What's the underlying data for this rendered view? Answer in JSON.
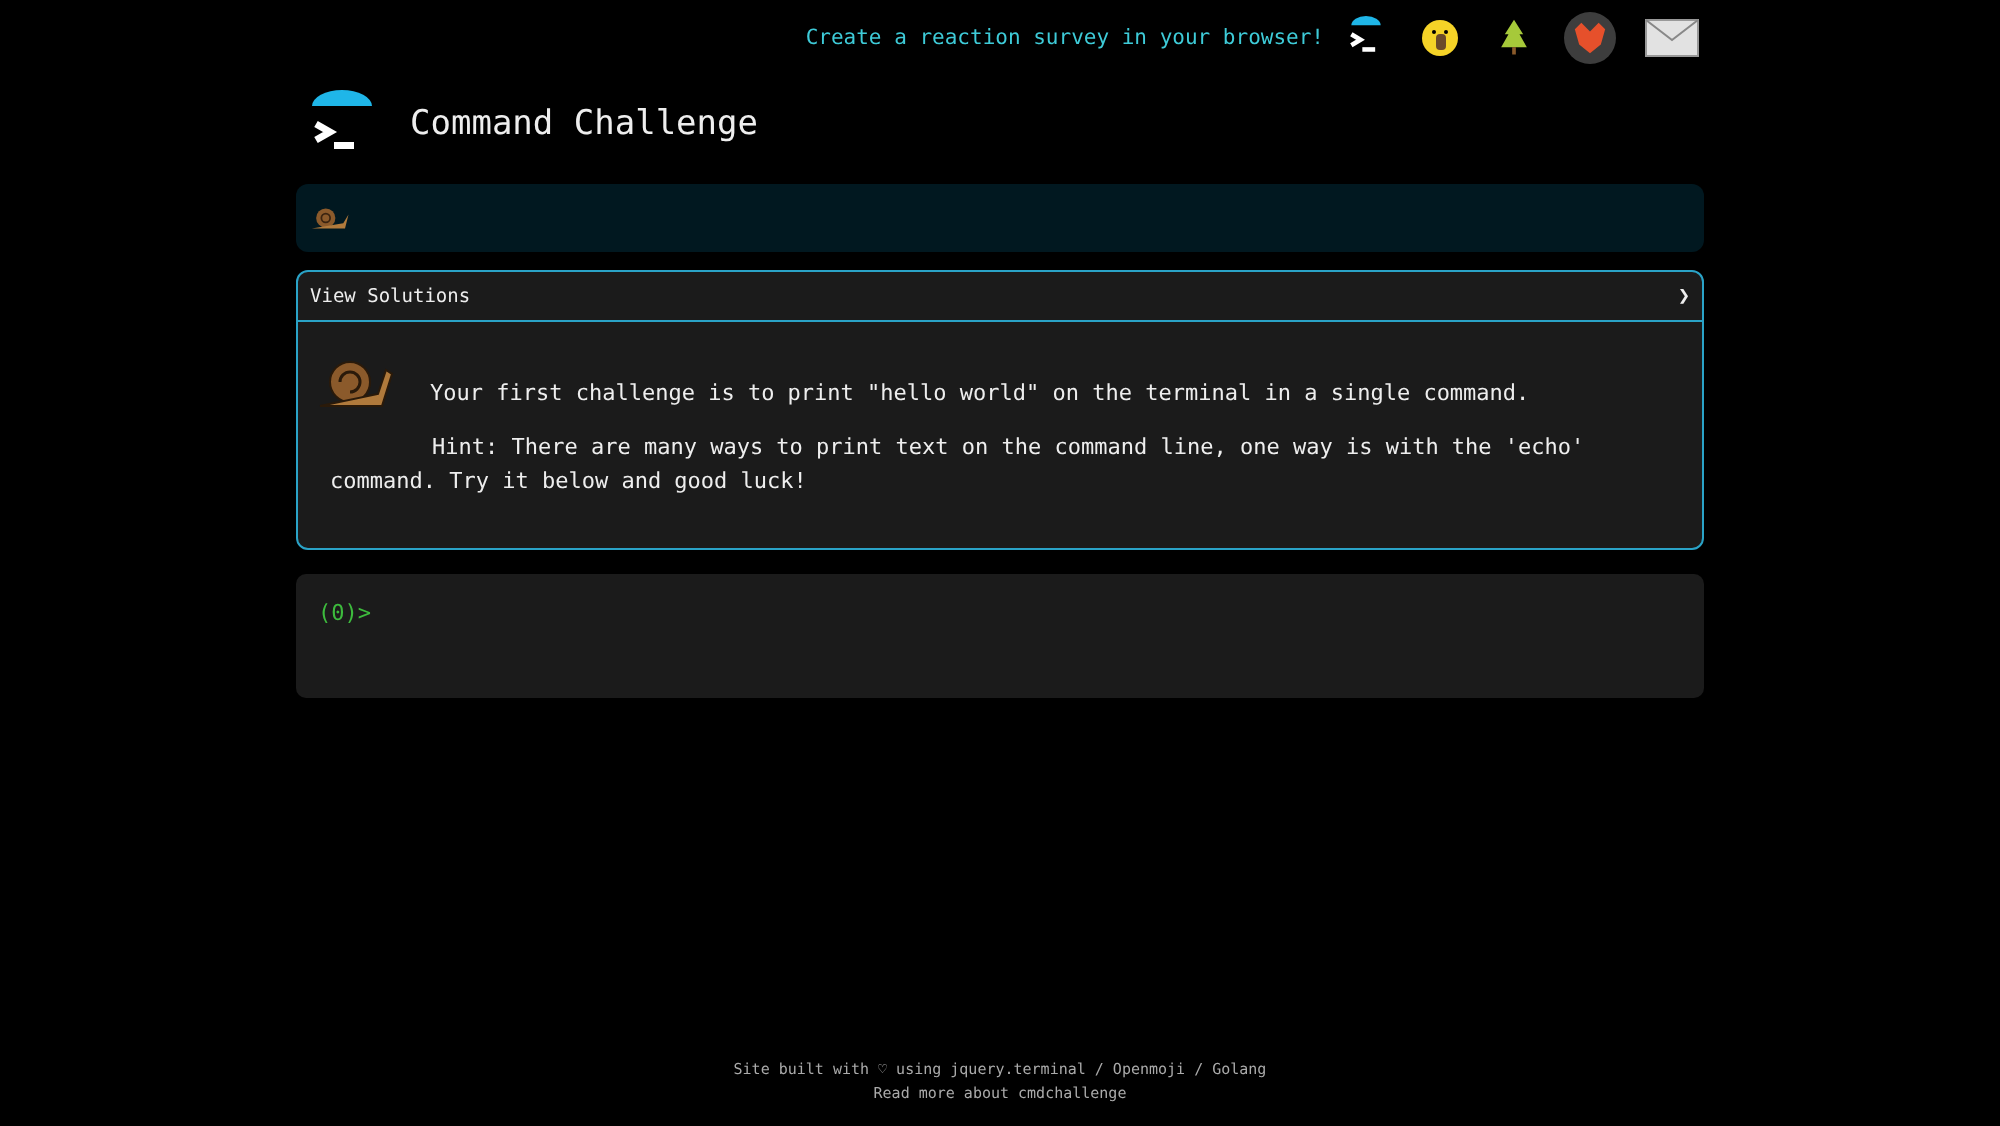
{
  "top_bar": {
    "promo_link": "Create a reaction survey in your browser!"
  },
  "header": {
    "title": "Command Challenge"
  },
  "solutions_panel": {
    "title": "View Solutions",
    "toggle": "❯",
    "paragraphs": [
      "Your first challenge is to print \"hello world\" on the terminal in a single command.",
      "Hint: There are many ways to print text on the command line, one way is with the 'echo' command. Try it below and good luck!"
    ]
  },
  "terminal": {
    "prompt": "(0)>"
  },
  "footer": {
    "lines": [
      "Site built with ♡ using jquery.terminal / Openmoji / Golang",
      "Read more about cmdchallenge"
    ]
  }
}
